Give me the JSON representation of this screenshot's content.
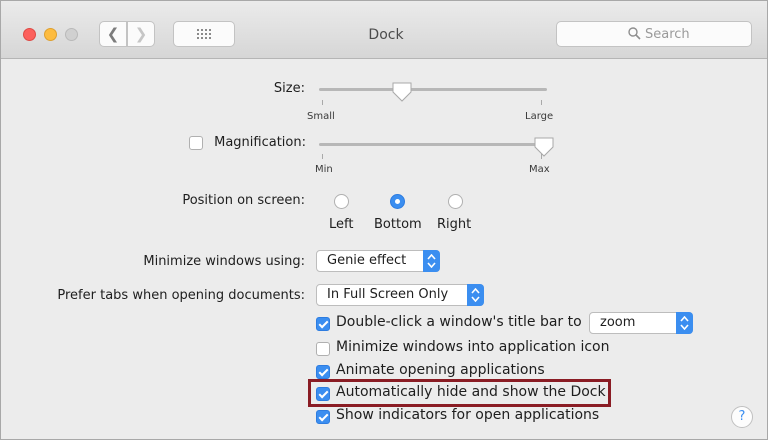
{
  "window": {
    "title": "Dock"
  },
  "toolbar": {
    "search_placeholder": "Search"
  },
  "size": {
    "label": "Size:",
    "min_label": "Small",
    "max_label": "Large",
    "value": 0.36
  },
  "magnification": {
    "label": "Magnification:",
    "checked": false,
    "min_label": "Min",
    "max_label": "Max",
    "value": 1.0
  },
  "position": {
    "label": "Position on screen:",
    "options": [
      {
        "label": "Left",
        "selected": false
      },
      {
        "label": "Bottom",
        "selected": true
      },
      {
        "label": "Right",
        "selected": false
      }
    ]
  },
  "minimize": {
    "label": "Minimize windows using:",
    "value": "Genie effect"
  },
  "prefer_tabs": {
    "label": "Prefer tabs when opening documents:",
    "value": "In Full Screen Only"
  },
  "options": [
    {
      "label": "Double-click a window's title bar to",
      "checked": true,
      "select_value": "zoom"
    },
    {
      "label": "Minimize windows into application icon",
      "checked": false
    },
    {
      "label": "Animate opening applications",
      "checked": true
    },
    {
      "label": "Automatically hide and show the Dock",
      "checked": true,
      "highlighted": true
    },
    {
      "label": "Show indicators for open applications",
      "checked": true
    }
  ],
  "help": {
    "label": "?"
  },
  "colors": {
    "accent": "#3b8ef0",
    "highlight_border": "#8a1c24",
    "background": "#ececec"
  }
}
